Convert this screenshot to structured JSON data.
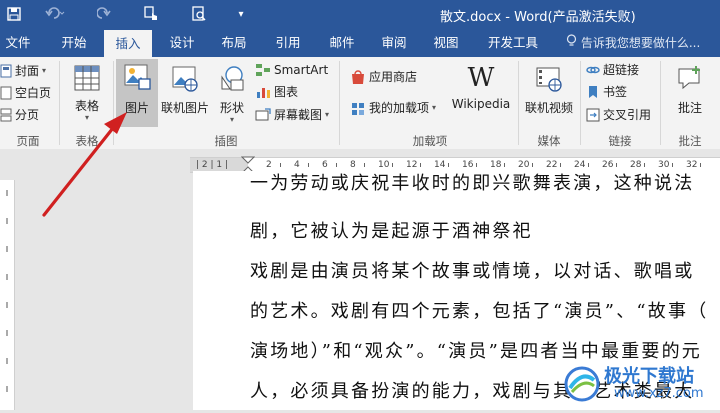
{
  "quick_access": {
    "save_icon": "save-icon",
    "undo_icon": "undo-icon",
    "redo_icon": "redo-icon",
    "touch_icon": "touch-mode-icon",
    "preview_icon": "print-preview-icon",
    "customize_icon": "customize-icon"
  },
  "title": "散文.docx - Word(产品激活失败)",
  "tabs": [
    "文件",
    "开始",
    "插入",
    "设计",
    "布局",
    "引用",
    "邮件",
    "审阅",
    "视图",
    "开发工具"
  ],
  "active_tab": "插入",
  "tell_me": "告诉我您想要做什么...",
  "ribbon": {
    "pages": {
      "label": "页面",
      "items": [
        "封面",
        "空白页",
        "分页"
      ]
    },
    "tables": {
      "label": "表格",
      "button": "表格"
    },
    "illustrations": {
      "label": "插图",
      "picture": "图片",
      "online_picture": "联机图片",
      "shapes": "形状",
      "smartart": "SmartArt",
      "chart": "图表",
      "screenshot": "屏幕截图"
    },
    "addins": {
      "label": "加载项",
      "store": "应用商店",
      "my_addins": "我的加载项",
      "wikipedia": "Wikipedia"
    },
    "media": {
      "label": "媒体",
      "online_video": "联机视频"
    },
    "links": {
      "label": "链接",
      "hyperlink": "超链接",
      "bookmark": "书签",
      "cross_ref": "交叉引用"
    },
    "comments": {
      "label": "批注",
      "comment": "批注"
    }
  },
  "ruler": {
    "left_marks": "| 2 | 1 |",
    "marks": [
      "2",
      "4",
      "6",
      "8",
      "10",
      "12",
      "14",
      "16",
      "18",
      "20",
      "22",
      "24",
      "26",
      "28",
      "30",
      "32"
    ]
  },
  "document": {
    "lines": [
      "一为劳动或庆祝丰收时的即兴歌舞表演，这种说法",
      "剧，它被认为是起源于酒神祭祀",
      "戏剧是由演员将某个故事或情境，以对话、歌唱或",
      "的艺术。戏剧有四个元素，包括了“演员”、“故事（",
      "演场地）”和“观众”。“演员”是四者当中最重要的元",
      "人，必须具备扮演的能力，戏剧与其它艺术类最大"
    ]
  },
  "watermark": {
    "name": "极光下载站",
    "url": "www.xz7.com"
  },
  "colors": {
    "word_blue": "#2b579a",
    "arrow_red": "#d02020",
    "ribbon_bg": "#f3f3f3",
    "selected_button": "#c5c5c5"
  }
}
